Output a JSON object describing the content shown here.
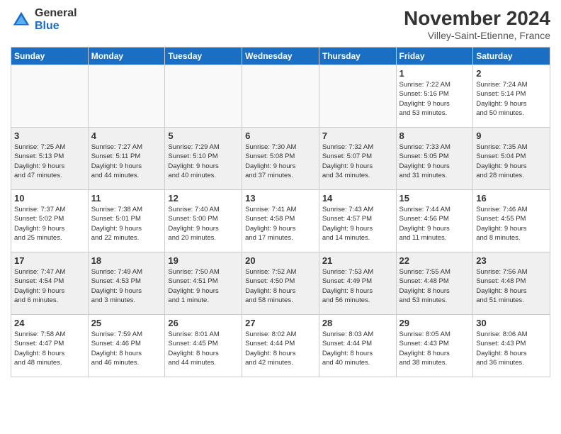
{
  "logo": {
    "general": "General",
    "blue": "Blue"
  },
  "header": {
    "month": "November 2024",
    "location": "Villey-Saint-Etienne, France"
  },
  "days_of_week": [
    "Sunday",
    "Monday",
    "Tuesday",
    "Wednesday",
    "Thursday",
    "Friday",
    "Saturday"
  ],
  "weeks": [
    {
      "shaded": false,
      "days": [
        {
          "num": "",
          "info": ""
        },
        {
          "num": "",
          "info": ""
        },
        {
          "num": "",
          "info": ""
        },
        {
          "num": "",
          "info": ""
        },
        {
          "num": "",
          "info": ""
        },
        {
          "num": "1",
          "info": "Sunrise: 7:22 AM\nSunset: 5:16 PM\nDaylight: 9 hours\nand 53 minutes."
        },
        {
          "num": "2",
          "info": "Sunrise: 7:24 AM\nSunset: 5:14 PM\nDaylight: 9 hours\nand 50 minutes."
        }
      ]
    },
    {
      "shaded": true,
      "days": [
        {
          "num": "3",
          "info": "Sunrise: 7:25 AM\nSunset: 5:13 PM\nDaylight: 9 hours\nand 47 minutes."
        },
        {
          "num": "4",
          "info": "Sunrise: 7:27 AM\nSunset: 5:11 PM\nDaylight: 9 hours\nand 44 minutes."
        },
        {
          "num": "5",
          "info": "Sunrise: 7:29 AM\nSunset: 5:10 PM\nDaylight: 9 hours\nand 40 minutes."
        },
        {
          "num": "6",
          "info": "Sunrise: 7:30 AM\nSunset: 5:08 PM\nDaylight: 9 hours\nand 37 minutes."
        },
        {
          "num": "7",
          "info": "Sunrise: 7:32 AM\nSunset: 5:07 PM\nDaylight: 9 hours\nand 34 minutes."
        },
        {
          "num": "8",
          "info": "Sunrise: 7:33 AM\nSunset: 5:05 PM\nDaylight: 9 hours\nand 31 minutes."
        },
        {
          "num": "9",
          "info": "Sunrise: 7:35 AM\nSunset: 5:04 PM\nDaylight: 9 hours\nand 28 minutes."
        }
      ]
    },
    {
      "shaded": false,
      "days": [
        {
          "num": "10",
          "info": "Sunrise: 7:37 AM\nSunset: 5:02 PM\nDaylight: 9 hours\nand 25 minutes."
        },
        {
          "num": "11",
          "info": "Sunrise: 7:38 AM\nSunset: 5:01 PM\nDaylight: 9 hours\nand 22 minutes."
        },
        {
          "num": "12",
          "info": "Sunrise: 7:40 AM\nSunset: 5:00 PM\nDaylight: 9 hours\nand 20 minutes."
        },
        {
          "num": "13",
          "info": "Sunrise: 7:41 AM\nSunset: 4:58 PM\nDaylight: 9 hours\nand 17 minutes."
        },
        {
          "num": "14",
          "info": "Sunrise: 7:43 AM\nSunset: 4:57 PM\nDaylight: 9 hours\nand 14 minutes."
        },
        {
          "num": "15",
          "info": "Sunrise: 7:44 AM\nSunset: 4:56 PM\nDaylight: 9 hours\nand 11 minutes."
        },
        {
          "num": "16",
          "info": "Sunrise: 7:46 AM\nSunset: 4:55 PM\nDaylight: 9 hours\nand 8 minutes."
        }
      ]
    },
    {
      "shaded": true,
      "days": [
        {
          "num": "17",
          "info": "Sunrise: 7:47 AM\nSunset: 4:54 PM\nDaylight: 9 hours\nand 6 minutes."
        },
        {
          "num": "18",
          "info": "Sunrise: 7:49 AM\nSunset: 4:53 PM\nDaylight: 9 hours\nand 3 minutes."
        },
        {
          "num": "19",
          "info": "Sunrise: 7:50 AM\nSunset: 4:51 PM\nDaylight: 9 hours\nand 1 minute."
        },
        {
          "num": "20",
          "info": "Sunrise: 7:52 AM\nSunset: 4:50 PM\nDaylight: 8 hours\nand 58 minutes."
        },
        {
          "num": "21",
          "info": "Sunrise: 7:53 AM\nSunset: 4:49 PM\nDaylight: 8 hours\nand 56 minutes."
        },
        {
          "num": "22",
          "info": "Sunrise: 7:55 AM\nSunset: 4:48 PM\nDaylight: 8 hours\nand 53 minutes."
        },
        {
          "num": "23",
          "info": "Sunrise: 7:56 AM\nSunset: 4:48 PM\nDaylight: 8 hours\nand 51 minutes."
        }
      ]
    },
    {
      "shaded": false,
      "days": [
        {
          "num": "24",
          "info": "Sunrise: 7:58 AM\nSunset: 4:47 PM\nDaylight: 8 hours\nand 48 minutes."
        },
        {
          "num": "25",
          "info": "Sunrise: 7:59 AM\nSunset: 4:46 PM\nDaylight: 8 hours\nand 46 minutes."
        },
        {
          "num": "26",
          "info": "Sunrise: 8:01 AM\nSunset: 4:45 PM\nDaylight: 8 hours\nand 44 minutes."
        },
        {
          "num": "27",
          "info": "Sunrise: 8:02 AM\nSunset: 4:44 PM\nDaylight: 8 hours\nand 42 minutes."
        },
        {
          "num": "28",
          "info": "Sunrise: 8:03 AM\nSunset: 4:44 PM\nDaylight: 8 hours\nand 40 minutes."
        },
        {
          "num": "29",
          "info": "Sunrise: 8:05 AM\nSunset: 4:43 PM\nDaylight: 8 hours\nand 38 minutes."
        },
        {
          "num": "30",
          "info": "Sunrise: 8:06 AM\nSunset: 4:43 PM\nDaylight: 8 hours\nand 36 minutes."
        }
      ]
    }
  ]
}
